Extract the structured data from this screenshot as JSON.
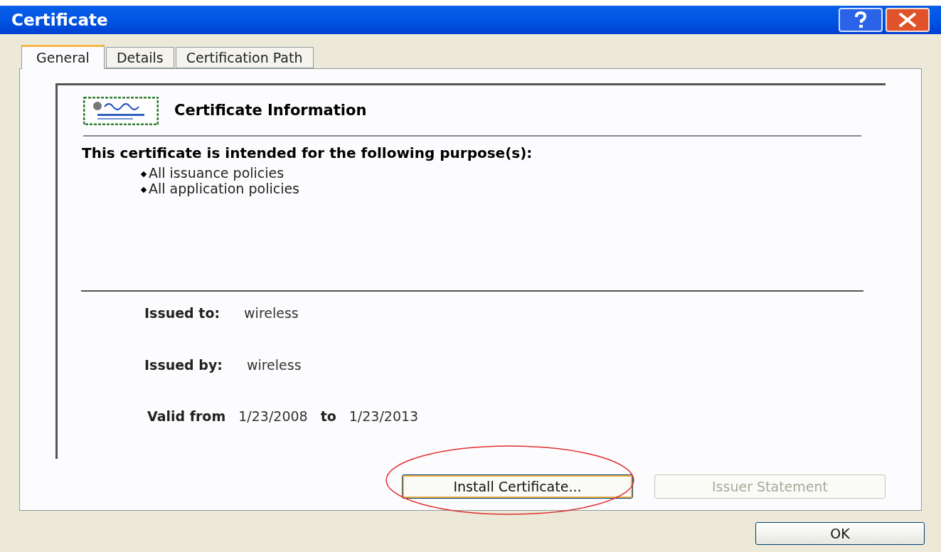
{
  "window": {
    "title": "Certificate"
  },
  "tabs": [
    {
      "label": "General",
      "selected": true
    },
    {
      "label": "Details",
      "selected": false
    },
    {
      "label": "Certification Path",
      "selected": false
    }
  ],
  "info": {
    "heading": "Certificate Information",
    "purpose_intro": "This certificate is intended for the following purpose(s):",
    "purposes": [
      "All issuance policies",
      "All application policies"
    ]
  },
  "fields": [
    {
      "label": "Issued to:",
      "value": "wireless"
    },
    {
      "label": "Issued by:",
      "value": "wireless"
    }
  ],
  "validity": {
    "from_label": "Valid from",
    "from": "1/23/2008",
    "to_label": "to",
    "to": "1/23/2013"
  },
  "panel_buttons": [
    {
      "label": "Install Certificate...",
      "disabled": false,
      "focused": true,
      "highlighted": true
    },
    {
      "label": "Issuer Statement",
      "disabled": true,
      "focused": false,
      "highlighted": false
    }
  ],
  "ok_button": {
    "label": "OK"
  }
}
